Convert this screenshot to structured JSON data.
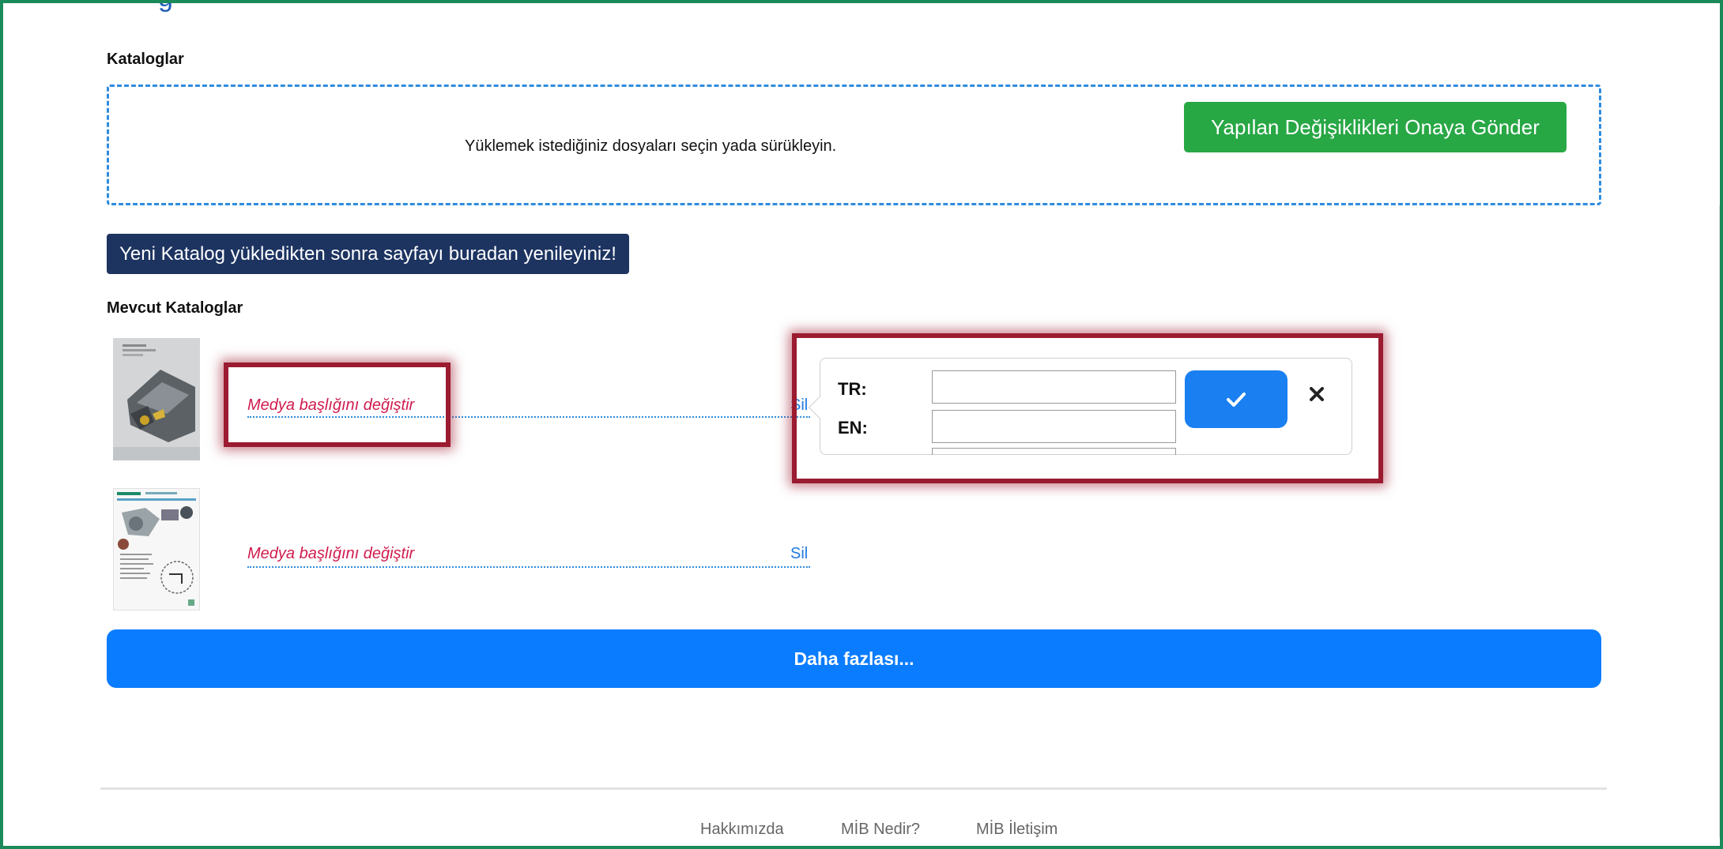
{
  "page": {
    "clipped_heading": "g"
  },
  "upload_section": {
    "title": "Kataloglar",
    "dropzone_text": "Yüklemek istediğiniz dosyaları seçin yada sürükleyin.",
    "submit_label": "Yapılan Değişiklikleri Onaya Gönder",
    "colors": {
      "submit": "#28a745",
      "dropzone_border": "#2f8cde"
    }
  },
  "refresh_button": {
    "label": "Yeni Katalog yükledikten sonra sayfayı buradan yenileyiniz!",
    "color": "#1d3461"
  },
  "existing": {
    "title": "Mevcut Kataloglar",
    "items": [
      {
        "title_label": "Medya başlığını değiştir",
        "delete_label": "Sil",
        "thumbnail": "catalog-cover-threading-tool"
      },
      {
        "title_label": "Medya başlığını değiştir",
        "delete_label": "Sil",
        "thumbnail": "catalog-cover-machine-diagram"
      }
    ]
  },
  "edit_popover": {
    "tr_label": "TR:",
    "en_label": "EN:",
    "tr_value": "",
    "en_value": "",
    "confirm_icon": "check-icon",
    "cancel_icon": "close-icon",
    "confirm_color": "#1a7ff0"
  },
  "more_button": {
    "label": "Daha fazlası...",
    "color": "#0a7cff"
  },
  "footer": {
    "links": [
      "Hakkımızda",
      "MİB Nedir?",
      "MİB İletişim"
    ]
  },
  "annotation": {
    "highlight_color": "#9b1b30"
  }
}
